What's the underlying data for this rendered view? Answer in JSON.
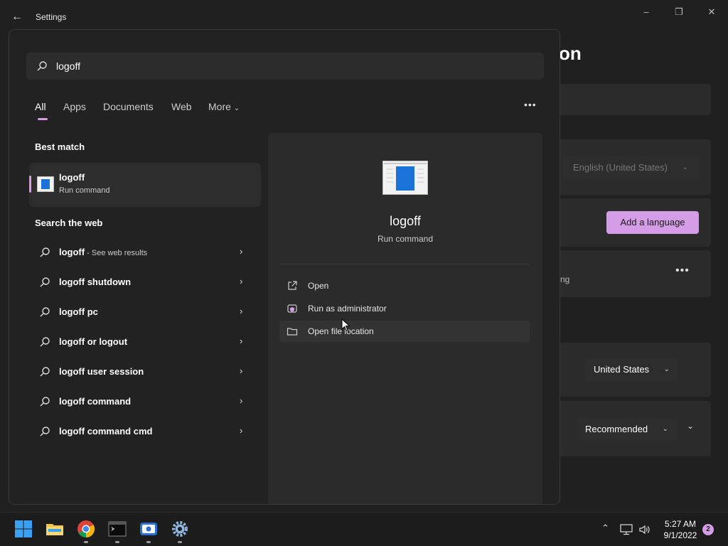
{
  "window": {
    "title": "Settings",
    "heading_fragment": "on",
    "language_select": "English (United States)",
    "add_language": "Add a language",
    "card_text_fragment": "ng",
    "region_select": "United States",
    "format_select": "Recommended"
  },
  "search": {
    "query": "logoff",
    "tabs": [
      "All",
      "Apps",
      "Documents",
      "Web",
      "More"
    ],
    "active_tab": "All"
  },
  "best_match": {
    "section_label": "Best match",
    "title": "logoff",
    "subtitle": "Run command"
  },
  "web": {
    "section_label": "Search the web",
    "items": [
      {
        "text": "logoff",
        "sub": " - See web results"
      },
      {
        "text": "logoff shutdown",
        "sub": ""
      },
      {
        "text": "logoff pc",
        "sub": ""
      },
      {
        "text": "logoff or logout",
        "sub": ""
      },
      {
        "text": "logoff user session",
        "sub": ""
      },
      {
        "text": "logoff command",
        "sub": ""
      },
      {
        "text": "logoff command cmd",
        "sub": ""
      }
    ]
  },
  "details": {
    "title": "logoff",
    "subtitle": "Run command",
    "actions": [
      {
        "label": "Open",
        "icon": "open-icon"
      },
      {
        "label": "Run as administrator",
        "icon": "shield-icon"
      },
      {
        "label": "Open file location",
        "icon": "folder-icon"
      }
    ]
  },
  "taskbar": {
    "icons": [
      "windows-start-icon",
      "file-explorer-icon",
      "chrome-icon",
      "terminal-icon",
      "capture-app-icon",
      "settings-icon"
    ],
    "time": "5:27 AM",
    "date": "9/1/2022",
    "notification_count": "2"
  },
  "colors": {
    "accent": "#d49de5",
    "background": "#202020",
    "panel": "#2b2b2b"
  }
}
